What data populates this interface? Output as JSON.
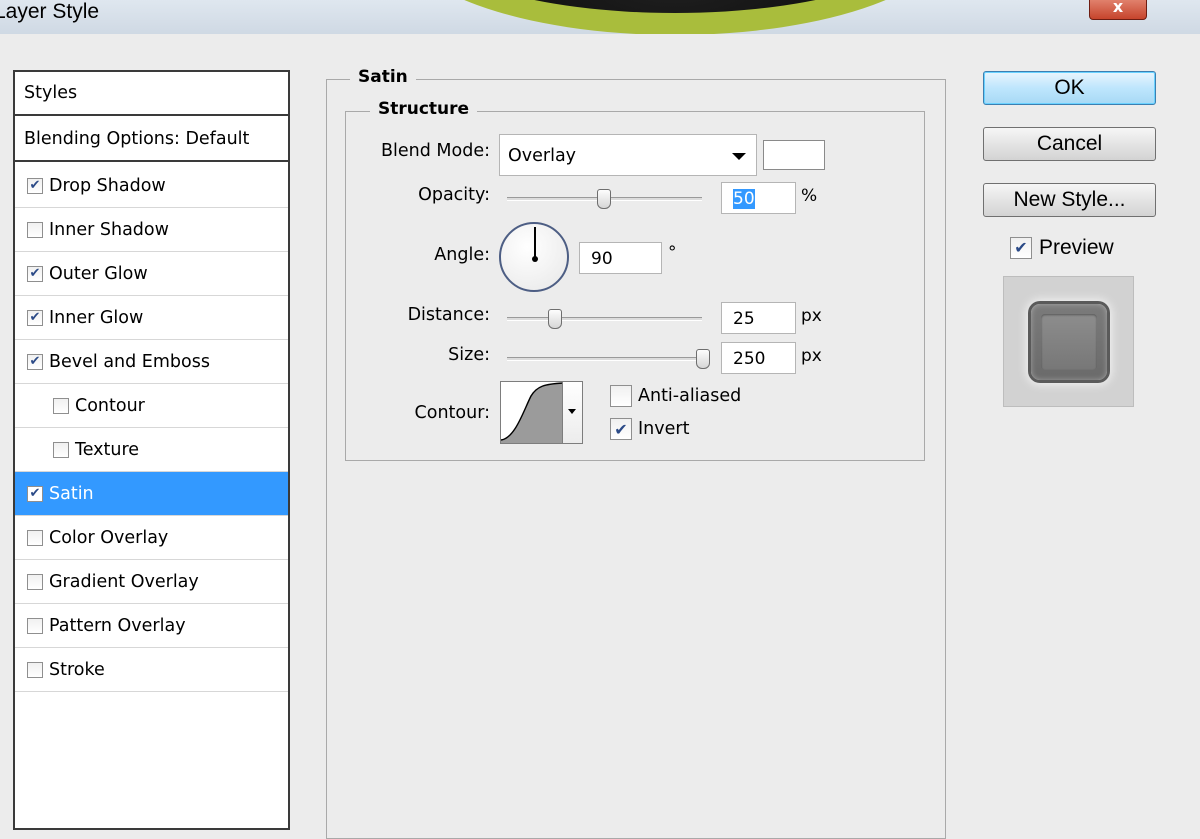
{
  "window": {
    "title": "Layer Style",
    "close_glyph": "x"
  },
  "styles_list": {
    "header": "Styles",
    "blending_options": "Blending Options: Default",
    "items": [
      {
        "label": "Drop Shadow",
        "checked": true,
        "indent": false,
        "selected": false
      },
      {
        "label": "Inner Shadow",
        "checked": false,
        "indent": false,
        "selected": false
      },
      {
        "label": "Outer Glow",
        "checked": true,
        "indent": false,
        "selected": false
      },
      {
        "label": "Inner Glow",
        "checked": true,
        "indent": false,
        "selected": false
      },
      {
        "label": "Bevel and Emboss",
        "checked": true,
        "indent": false,
        "selected": false
      },
      {
        "label": "Contour",
        "checked": false,
        "indent": true,
        "selected": false
      },
      {
        "label": "Texture",
        "checked": false,
        "indent": true,
        "selected": false
      },
      {
        "label": "Satin",
        "checked": true,
        "indent": false,
        "selected": true
      },
      {
        "label": "Color Overlay",
        "checked": false,
        "indent": false,
        "selected": false
      },
      {
        "label": "Gradient Overlay",
        "checked": false,
        "indent": false,
        "selected": false
      },
      {
        "label": "Pattern Overlay",
        "checked": false,
        "indent": false,
        "selected": false
      },
      {
        "label": "Stroke",
        "checked": false,
        "indent": false,
        "selected": false
      }
    ]
  },
  "satin": {
    "group_title": "Satin",
    "structure_title": "Structure",
    "blend_mode_label": "Blend Mode:",
    "blend_mode_value": "Overlay",
    "blend_color": "#ffffff",
    "opacity_label": "Opacity:",
    "opacity_value": "50",
    "opacity_unit": "%",
    "angle_label": "Angle:",
    "angle_value": "90",
    "angle_unit": "°",
    "distance_label": "Distance:",
    "distance_value": "25",
    "distance_unit": "px",
    "size_label": "Size:",
    "size_value": "250",
    "size_unit": "px",
    "contour_label": "Contour:",
    "anti_aliased_label": "Anti-aliased",
    "anti_aliased_checked": false,
    "invert_label": "Invert",
    "invert_checked": true
  },
  "buttons": {
    "ok": "OK",
    "cancel": "Cancel",
    "new_style": "New Style...",
    "preview_label": "Preview",
    "preview_checked": true
  },
  "colors": {
    "selection": "#3399ff",
    "dialog_bg": "#ececec",
    "check_mark": "#2b4a87"
  }
}
